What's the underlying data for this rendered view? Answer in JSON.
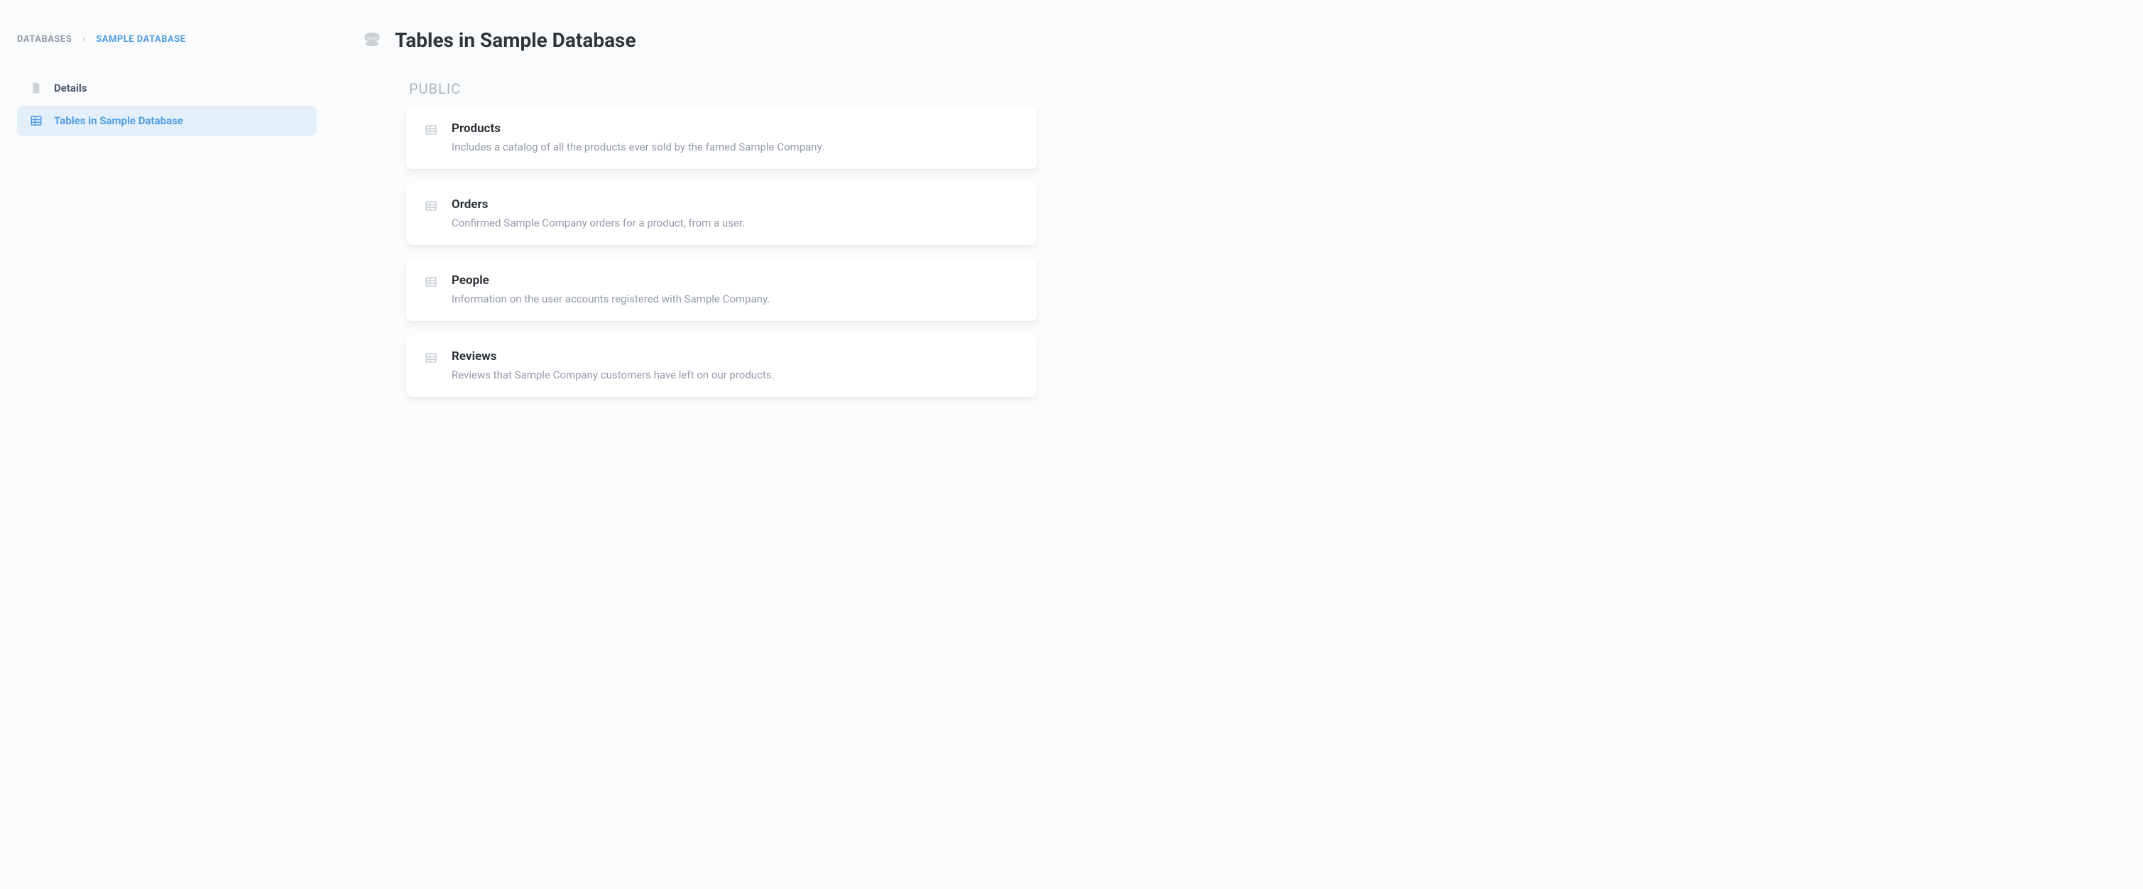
{
  "breadcrumb": {
    "root": "Databases",
    "current": "Sample Database"
  },
  "sidebar": {
    "items": [
      {
        "label": "Details"
      },
      {
        "label": "Tables in Sample Database"
      }
    ]
  },
  "main": {
    "title": "Tables in Sample Database",
    "schema_label": "PUBLIC",
    "tables": [
      {
        "name": "Products",
        "description": "Includes a catalog of all the products ever sold by the famed Sample Company."
      },
      {
        "name": "Orders",
        "description": "Confirmed Sample Company orders for a product, from a user."
      },
      {
        "name": "People",
        "description": "Information on the user accounts registered with Sample Company."
      },
      {
        "name": "Reviews",
        "description": "Reviews that Sample Company customers have left on our products."
      }
    ]
  }
}
